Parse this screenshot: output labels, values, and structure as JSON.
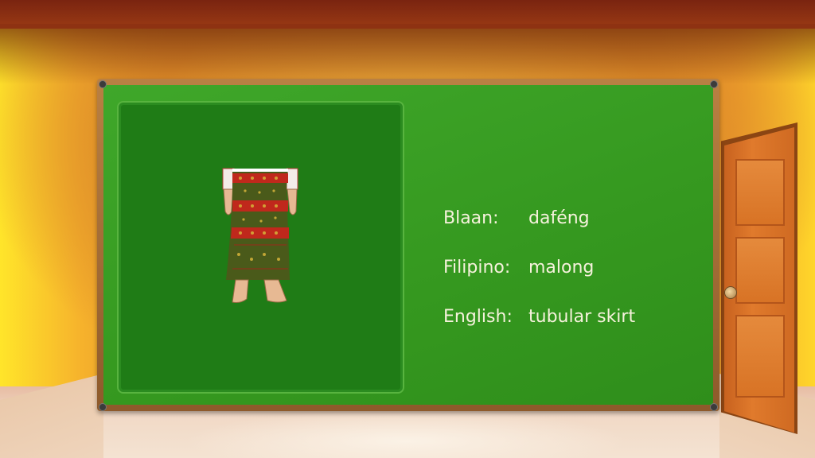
{
  "flashcard": {
    "image_subject": "tubular skirt",
    "rows": [
      {
        "language": "Blaan:",
        "word": "daféng"
      },
      {
        "language": "Filipino:",
        "word": "malong"
      },
      {
        "language": "English:",
        "word": "tubular skirt"
      }
    ]
  },
  "colors": {
    "board_green": "#3fa72a",
    "panel_green": "#1f7c16",
    "chalk_text": "#f6f2dc",
    "frame_wood": "#a56d36",
    "door_orange": "#e07a2c"
  }
}
